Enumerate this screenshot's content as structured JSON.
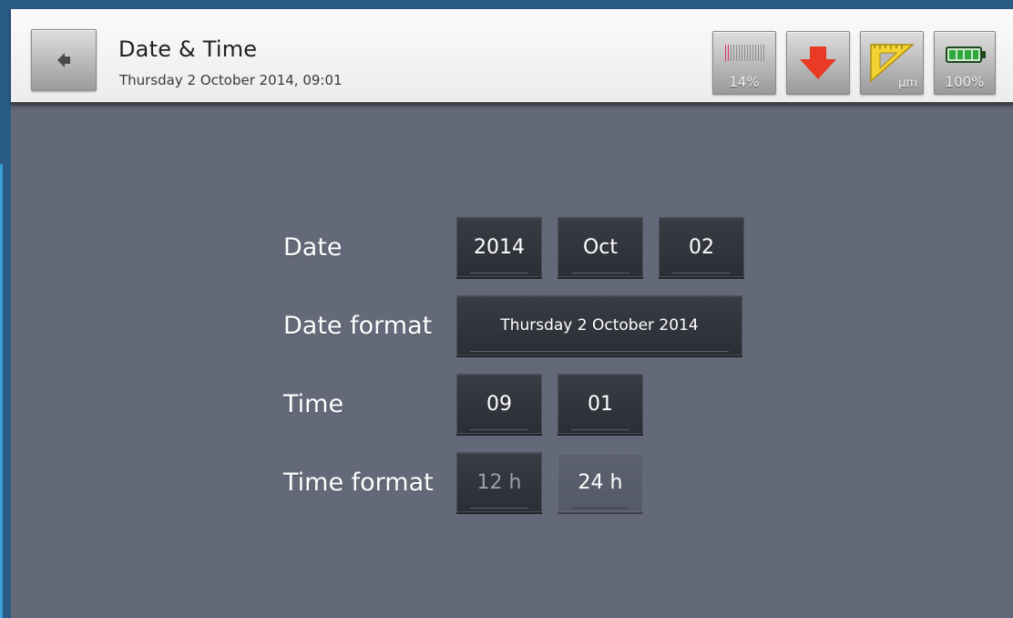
{
  "header": {
    "title": "Date & Time",
    "subtitle": "Thursday 2 October 2014, 09:01",
    "back_icon": "back-arrow-icon"
  },
  "status": {
    "signal": {
      "icon": "signal-strength-icon",
      "label": "14%",
      "level": 0.14
    },
    "alert": {
      "icon": "down-arrow-icon",
      "color": "#e83a24"
    },
    "units": {
      "icon": "ruler-triangle-icon",
      "label": "µm"
    },
    "battery": {
      "icon": "battery-icon",
      "label": "100%",
      "level": 1.0
    }
  },
  "form": {
    "date": {
      "label": "Date",
      "year": "2014",
      "month": "Oct",
      "day": "02"
    },
    "date_format": {
      "label": "Date format",
      "value": "Thursday 2 October 2014"
    },
    "time": {
      "label": "Time",
      "hour": "09",
      "minute": "01"
    },
    "time_format": {
      "label": "Time format",
      "options": [
        "12 h",
        "24 h"
      ],
      "selected": "24 h"
    }
  }
}
